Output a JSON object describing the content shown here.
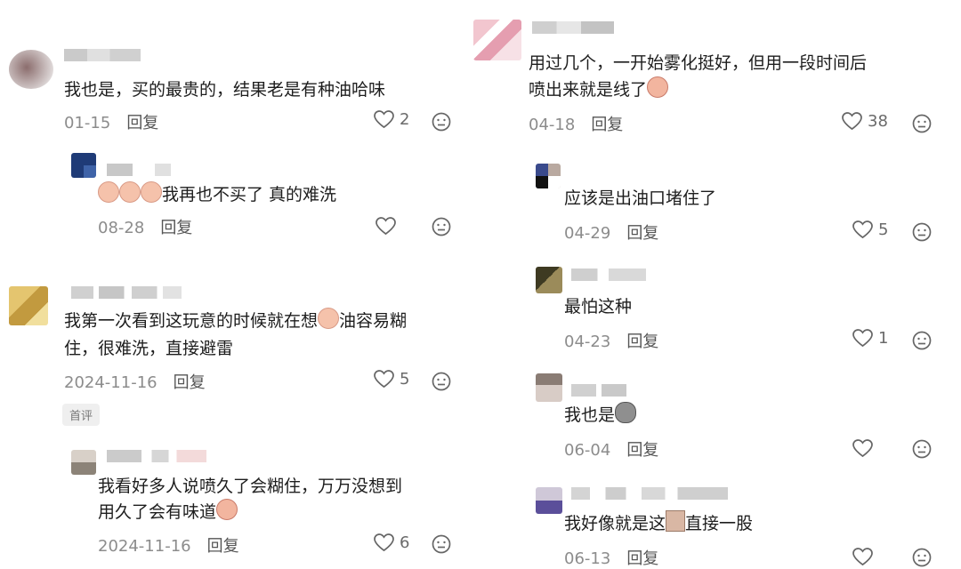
{
  "left": {
    "c1": {
      "text": "我也是，买的最贵的，结果老是有种油哈味",
      "date": "01-15",
      "reply": "回复",
      "likes": "2",
      "avatar_color": "#7a5b5b"
    },
    "c1r": {
      "text": "我再也不买了 真的难洗",
      "date": "08-28",
      "reply": "回复"
    },
    "c2": {
      "text1": "我第一次看到这玩意的时候就在想",
      "text1b": "油容易糊",
      "text2": "住，很难洗，直接避雷",
      "date": "2024-11-16",
      "reply": "回复",
      "likes": "5",
      "badge": "首评"
    },
    "c2r": {
      "text1": "我看好多人说喷久了会糊住，万万没想到",
      "text2": "用久了会有味道",
      "date": "2024-11-16",
      "reply": "回复",
      "likes": "6"
    }
  },
  "right": {
    "c1": {
      "text1": "用过几个，一开始雾化挺好，但用一段时间后",
      "text2": "喷出来就是线了",
      "date": "04-18",
      "reply": "回复",
      "likes": "38"
    },
    "c2": {
      "text": "应该是出油口堵住了",
      "date": "04-29",
      "reply": "回复",
      "likes": "5"
    },
    "c3": {
      "text": "最怕这种",
      "date": "04-23",
      "reply": "回复",
      "likes": "1"
    },
    "c4": {
      "text": "我也是",
      "date": "06-04",
      "reply": "回复"
    },
    "c5": {
      "text1": "我好像就是这",
      "text2": "直接一股",
      "date": "06-13",
      "reply": "回复"
    }
  }
}
